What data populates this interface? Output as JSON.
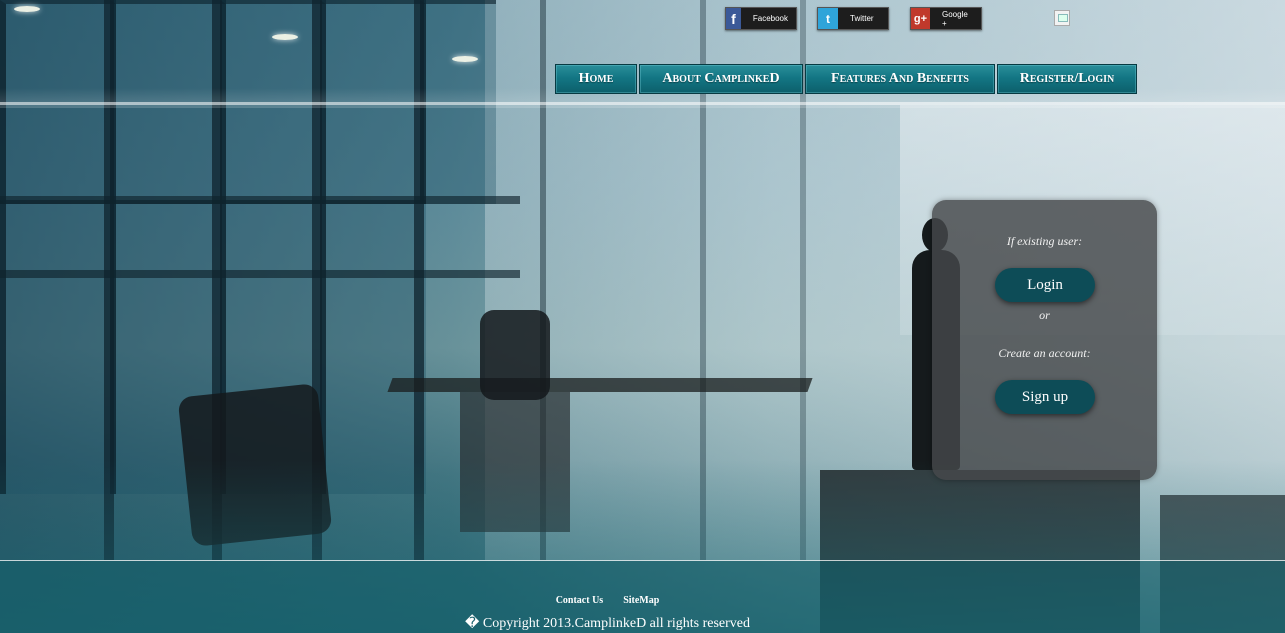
{
  "social": {
    "facebook": {
      "label": "Facebook",
      "glyph": "f",
      "color": "#3b5998"
    },
    "twitter": {
      "label": "Twitter",
      "glyph": "t",
      "color": "#2fa4d9"
    },
    "google": {
      "label": "Google +",
      "glyph": "g+",
      "color": "#c0392b"
    }
  },
  "nav": {
    "home": "Home",
    "about": "About CamplinkeD",
    "features": "Features And Benefits",
    "register": "Register/Login"
  },
  "panel": {
    "existing_prompt": "If existing user:",
    "login_label": "Login",
    "or_text": "or",
    "create_prompt": "Create an account:",
    "signup_label": "Sign up"
  },
  "footer": {
    "contact": "Contact Us",
    "sitemap": "SiteMap",
    "copyright": "� Copyright 2013.CamplinkeD all rights reserved"
  },
  "colors": {
    "nav_accent": "#137684",
    "button": "#0d4c57",
    "panel": "#46484a"
  }
}
